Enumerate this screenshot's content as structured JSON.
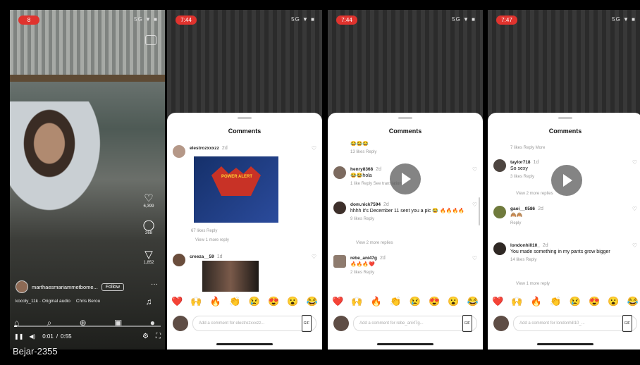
{
  "watermark": "Bejar-2355",
  "panel1": {
    "status_time": "8",
    "status_icons": "5G ▼ ■",
    "likes_count": "6,399",
    "comments_count": "268",
    "shares_count": "1,852",
    "creator_name": "marthaesmariammetbome...",
    "follow_label": "Follow",
    "more": "···",
    "audio": [
      "kocoly_11k · Original audio",
      "Chris Berou"
    ],
    "time_current": "0:01",
    "time_total": "0:55",
    "progress": 0.02
  },
  "panel2": {
    "status_time": "7:44",
    "status_icons": "5G ▼ ■",
    "title": "Comments",
    "comments": [
      {
        "user": "elestrozxxxzz",
        "time": "2d",
        "text": "",
        "meta": "67 likes   Reply"
      },
      {
        "user": "creeza__59",
        "time": "1d",
        "text": "",
        "meta": ""
      }
    ],
    "view_replies": "View 1 more reply",
    "image_label": "POWER ALERT",
    "emojis": [
      "❤️",
      "🙌",
      "🔥",
      "👏",
      "😢",
      "😍",
      "😮",
      "😂"
    ],
    "input_placeholder": "Add a comment for elestrozxxxzz...",
    "gif": "GIF"
  },
  "panel3": {
    "status_time": "7:44",
    "status_icons": "5G ▼ ■",
    "title": "Comments",
    "comments": [
      {
        "user": "",
        "time": "",
        "text": "😂😂😂",
        "meta": "13 likes   Reply"
      },
      {
        "user": "henry8368",
        "time": "2d",
        "text": "😂😂hola",
        "meta": "1 like   Reply   See translation"
      },
      {
        "user": "dom.nick7594",
        "time": "2d",
        "text": "hhhh it's December 11 sent you a pic 😂 🔥🔥🔥🔥",
        "meta": "9 likes   Reply"
      },
      {
        "user": "rebe_ani47g",
        "time": "2d",
        "text": "🔥🔥🔥❤️",
        "meta": "2 likes   Reply"
      }
    ],
    "view_replies": "View 2 more replies",
    "emojis": [
      "❤️",
      "🙌",
      "🔥",
      "👏",
      "😢",
      "😍",
      "😮",
      "😂"
    ],
    "input_placeholder": "Add a comment for rebe_ani47g...",
    "gif": "GIF"
  },
  "panel4": {
    "status_time": "7:47",
    "status_icons": "5G ▼ ■",
    "title": "Comments",
    "top_meta": "7 likes   Reply   More",
    "comments": [
      {
        "user": "taylor718",
        "time": "1d",
        "text": "So sexy",
        "meta": "3 likes   Reply"
      },
      {
        "user": "gaoi__0586",
        "time": "2d",
        "text": "🙈🙈",
        "meta": "Reply"
      },
      {
        "user": "londonhill10_",
        "time": "2d",
        "text": "You made something in my pants grow bigger",
        "meta": "14 likes   Reply"
      }
    ],
    "view_replies_1": "View 2 more replies",
    "view_replies_2": "View 1 more reply",
    "emojis": [
      "❤️",
      "🙌",
      "🔥",
      "👏",
      "😢",
      "😍",
      "😮",
      "😂"
    ],
    "input_placeholder": "Add a comment for londonhill10_...",
    "gif": "GIF"
  }
}
